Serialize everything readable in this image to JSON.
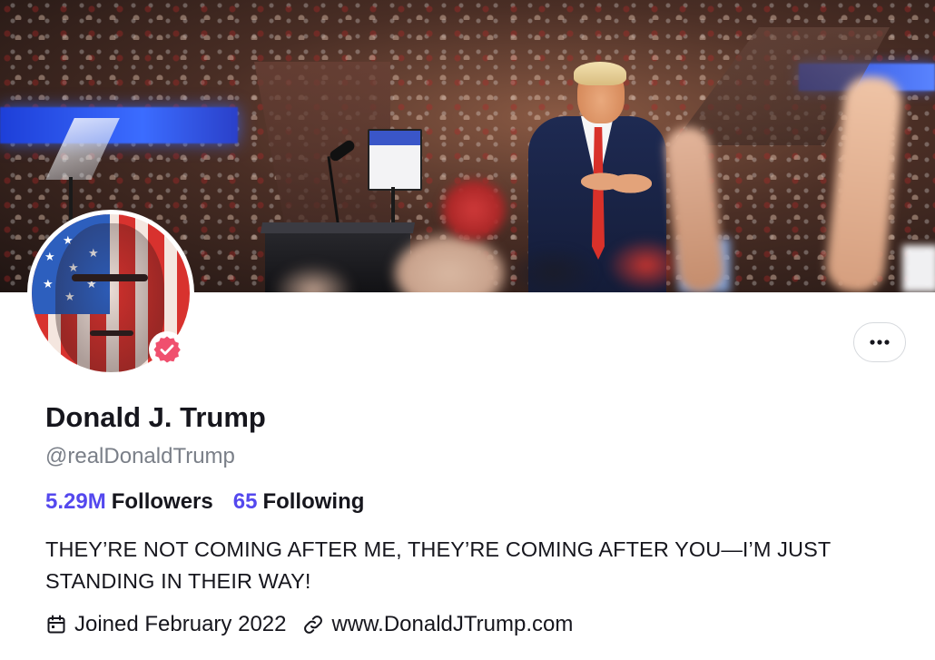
{
  "profile": {
    "display_name": "Donald J. Trump",
    "handle": "@realDonaldTrump",
    "verified": true,
    "verified_badge_color": "#f0506e",
    "stats": {
      "followers_count": "5.29M",
      "followers_label": "Followers",
      "following_count": "65",
      "following_label": "Following"
    },
    "bio": "THEY’RE NOT COMING AFTER ME, THEY’RE COMING AFTER YOU—I’M JUST STANDING IN THEIR WAY!",
    "joined": "Joined February 2022",
    "website": "www.DonaldJTrump.com"
  },
  "icons": {
    "calendar": "calendar-icon",
    "link": "link-icon",
    "more": "more-horizontal-icon",
    "verified": "verified-badge-icon"
  },
  "colors": {
    "accent": "#5448ee",
    "text": "#16161d",
    "muted": "#7a7f88",
    "border": "#d6d9dd"
  }
}
